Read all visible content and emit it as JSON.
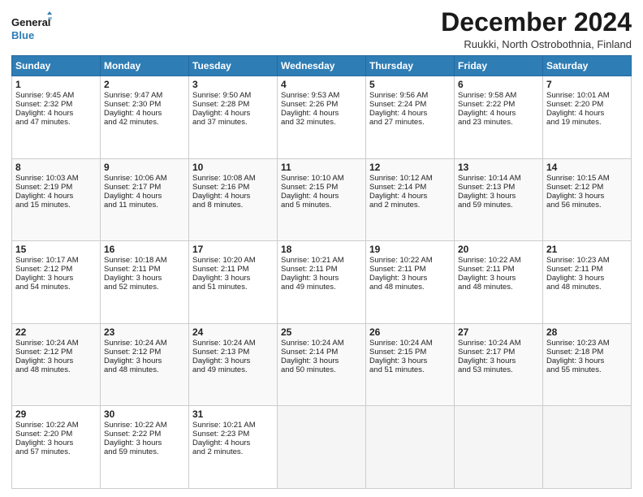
{
  "header": {
    "logo_line1": "General",
    "logo_line2": "Blue",
    "month_title": "December 2024",
    "subtitle": "Ruukki, North Ostrobothnia, Finland"
  },
  "days_of_week": [
    "Sunday",
    "Monday",
    "Tuesday",
    "Wednesday",
    "Thursday",
    "Friday",
    "Saturday"
  ],
  "weeks": [
    [
      {
        "day": "1",
        "lines": [
          "Sunrise: 9:45 AM",
          "Sunset: 2:32 PM",
          "Daylight: 4 hours",
          "and 47 minutes."
        ]
      },
      {
        "day": "2",
        "lines": [
          "Sunrise: 9:47 AM",
          "Sunset: 2:30 PM",
          "Daylight: 4 hours",
          "and 42 minutes."
        ]
      },
      {
        "day": "3",
        "lines": [
          "Sunrise: 9:50 AM",
          "Sunset: 2:28 PM",
          "Daylight: 4 hours",
          "and 37 minutes."
        ]
      },
      {
        "day": "4",
        "lines": [
          "Sunrise: 9:53 AM",
          "Sunset: 2:26 PM",
          "Daylight: 4 hours",
          "and 32 minutes."
        ]
      },
      {
        "day": "5",
        "lines": [
          "Sunrise: 9:56 AM",
          "Sunset: 2:24 PM",
          "Daylight: 4 hours",
          "and 27 minutes."
        ]
      },
      {
        "day": "6",
        "lines": [
          "Sunrise: 9:58 AM",
          "Sunset: 2:22 PM",
          "Daylight: 4 hours",
          "and 23 minutes."
        ]
      },
      {
        "day": "7",
        "lines": [
          "Sunrise: 10:01 AM",
          "Sunset: 2:20 PM",
          "Daylight: 4 hours",
          "and 19 minutes."
        ]
      }
    ],
    [
      {
        "day": "8",
        "lines": [
          "Sunrise: 10:03 AM",
          "Sunset: 2:19 PM",
          "Daylight: 4 hours",
          "and 15 minutes."
        ]
      },
      {
        "day": "9",
        "lines": [
          "Sunrise: 10:06 AM",
          "Sunset: 2:17 PM",
          "Daylight: 4 hours",
          "and 11 minutes."
        ]
      },
      {
        "day": "10",
        "lines": [
          "Sunrise: 10:08 AM",
          "Sunset: 2:16 PM",
          "Daylight: 4 hours",
          "and 8 minutes."
        ]
      },
      {
        "day": "11",
        "lines": [
          "Sunrise: 10:10 AM",
          "Sunset: 2:15 PM",
          "Daylight: 4 hours",
          "and 5 minutes."
        ]
      },
      {
        "day": "12",
        "lines": [
          "Sunrise: 10:12 AM",
          "Sunset: 2:14 PM",
          "Daylight: 4 hours",
          "and 2 minutes."
        ]
      },
      {
        "day": "13",
        "lines": [
          "Sunrise: 10:14 AM",
          "Sunset: 2:13 PM",
          "Daylight: 3 hours",
          "and 59 minutes."
        ]
      },
      {
        "day": "14",
        "lines": [
          "Sunrise: 10:15 AM",
          "Sunset: 2:12 PM",
          "Daylight: 3 hours",
          "and 56 minutes."
        ]
      }
    ],
    [
      {
        "day": "15",
        "lines": [
          "Sunrise: 10:17 AM",
          "Sunset: 2:12 PM",
          "Daylight: 3 hours",
          "and 54 minutes."
        ]
      },
      {
        "day": "16",
        "lines": [
          "Sunrise: 10:18 AM",
          "Sunset: 2:11 PM",
          "Daylight: 3 hours",
          "and 52 minutes."
        ]
      },
      {
        "day": "17",
        "lines": [
          "Sunrise: 10:20 AM",
          "Sunset: 2:11 PM",
          "Daylight: 3 hours",
          "and 51 minutes."
        ]
      },
      {
        "day": "18",
        "lines": [
          "Sunrise: 10:21 AM",
          "Sunset: 2:11 PM",
          "Daylight: 3 hours",
          "and 49 minutes."
        ]
      },
      {
        "day": "19",
        "lines": [
          "Sunrise: 10:22 AM",
          "Sunset: 2:11 PM",
          "Daylight: 3 hours",
          "and 48 minutes."
        ]
      },
      {
        "day": "20",
        "lines": [
          "Sunrise: 10:22 AM",
          "Sunset: 2:11 PM",
          "Daylight: 3 hours",
          "and 48 minutes."
        ]
      },
      {
        "day": "21",
        "lines": [
          "Sunrise: 10:23 AM",
          "Sunset: 2:11 PM",
          "Daylight: 3 hours",
          "and 48 minutes."
        ]
      }
    ],
    [
      {
        "day": "22",
        "lines": [
          "Sunrise: 10:24 AM",
          "Sunset: 2:12 PM",
          "Daylight: 3 hours",
          "and 48 minutes."
        ]
      },
      {
        "day": "23",
        "lines": [
          "Sunrise: 10:24 AM",
          "Sunset: 2:12 PM",
          "Daylight: 3 hours",
          "and 48 minutes."
        ]
      },
      {
        "day": "24",
        "lines": [
          "Sunrise: 10:24 AM",
          "Sunset: 2:13 PM",
          "Daylight: 3 hours",
          "and 49 minutes."
        ]
      },
      {
        "day": "25",
        "lines": [
          "Sunrise: 10:24 AM",
          "Sunset: 2:14 PM",
          "Daylight: 3 hours",
          "and 50 minutes."
        ]
      },
      {
        "day": "26",
        "lines": [
          "Sunrise: 10:24 AM",
          "Sunset: 2:15 PM",
          "Daylight: 3 hours",
          "and 51 minutes."
        ]
      },
      {
        "day": "27",
        "lines": [
          "Sunrise: 10:24 AM",
          "Sunset: 2:17 PM",
          "Daylight: 3 hours",
          "and 53 minutes."
        ]
      },
      {
        "day": "28",
        "lines": [
          "Sunrise: 10:23 AM",
          "Sunset: 2:18 PM",
          "Daylight: 3 hours",
          "and 55 minutes."
        ]
      }
    ],
    [
      {
        "day": "29",
        "lines": [
          "Sunrise: 10:22 AM",
          "Sunset: 2:20 PM",
          "Daylight: 3 hours",
          "and 57 minutes."
        ]
      },
      {
        "day": "30",
        "lines": [
          "Sunrise: 10:22 AM",
          "Sunset: 2:22 PM",
          "Daylight: 3 hours",
          "and 59 minutes."
        ]
      },
      {
        "day": "31",
        "lines": [
          "Sunrise: 10:21 AM",
          "Sunset: 2:23 PM",
          "Daylight: 4 hours",
          "and 2 minutes."
        ]
      },
      null,
      null,
      null,
      null
    ]
  ]
}
